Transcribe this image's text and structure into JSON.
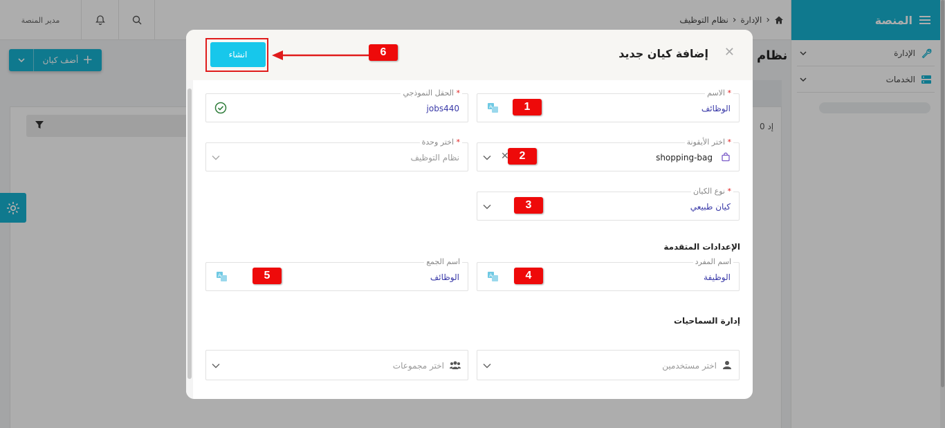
{
  "topbar": {
    "user": "مدير المنصة",
    "breadcrumb": [
      "الإدارة",
      "نظام التوظيف"
    ]
  },
  "sidebar": {
    "title": "المنصة",
    "items": [
      {
        "label": "الإدارة",
        "icon": "wrench-icon"
      },
      {
        "label": "الخدمات",
        "icon": "server-icon"
      }
    ]
  },
  "page": {
    "add_entity_label": "أضف كيان",
    "title_partial": "نظام",
    "count_partial": "0 إد"
  },
  "modal": {
    "title": "إضافة كيان جديد",
    "create_label": "انشاء",
    "fields": {
      "name": {
        "label": "الاسم",
        "value": "الوظائف"
      },
      "model_field": {
        "label": "الحقل النموذجي",
        "value": "jobs440"
      },
      "icon": {
        "label": "اختر الأيقونة",
        "value": "shopping-bag"
      },
      "unit": {
        "label": "اختر وحدة",
        "value": "نظام التوظيف"
      },
      "entity_type": {
        "label": "نوع الكيان",
        "value": "كيان طبيعي"
      },
      "singular": {
        "label": "اسم المفرد",
        "value": "الوظيفة"
      },
      "plural": {
        "label": "اسم الجمع",
        "value": "الوظائف"
      },
      "users": {
        "placeholder": "اختر مستخدمين"
      },
      "groups": {
        "placeholder": "اختر مجموعات"
      }
    },
    "sections": {
      "advanced": "الإعدادات المتقدمة",
      "permissions": "إدارة السماحيات"
    }
  },
  "annotations": [
    "1",
    "2",
    "3",
    "4",
    "5",
    "6"
  ],
  "colors": {
    "accent": "#17b3d1",
    "create_button": "#17c7eb",
    "annotation": "#ee0a0a",
    "value_text": "#3a3aa8"
  }
}
